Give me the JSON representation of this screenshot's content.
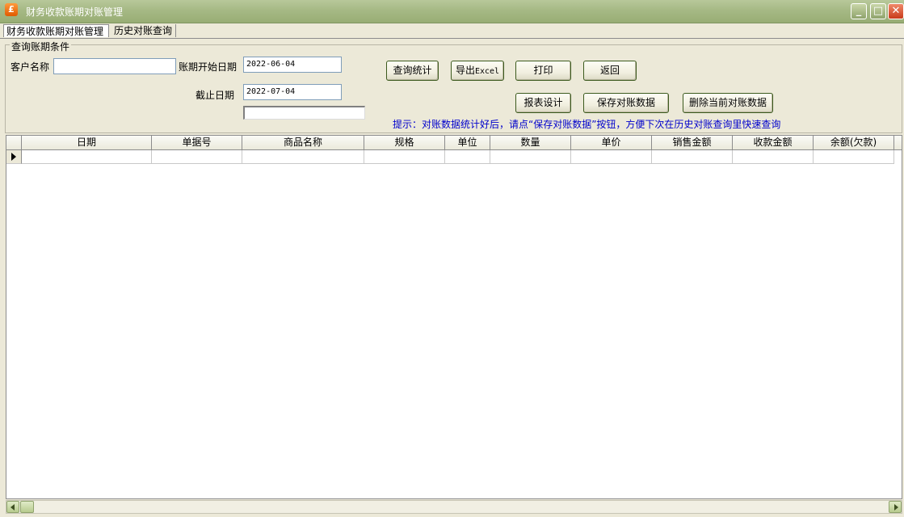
{
  "window": {
    "title": "财务收款账期对账管理",
    "icon": "app-icon",
    "icon_glyph": "£",
    "minimize": "_",
    "maximize": "□",
    "close": "✕"
  },
  "tabs": [
    {
      "label": "财务收款账期对账管理",
      "active": true
    },
    {
      "label": "历史对账查询",
      "active": false
    }
  ],
  "query": {
    "group_title": "查询账期条件",
    "customer_label": "客户名称",
    "customer_value": "",
    "start_label": "账期开始日期",
    "start_value": "2022-06-04",
    "end_label": "截止日期",
    "end_value": "2022-07-04",
    "extra_value": ""
  },
  "buttons": {
    "query_stats": "查询统计",
    "export_excel_prefix": "导出",
    "export_excel_suffix": "Excel",
    "print": "打印",
    "back": "返回",
    "report_design": "报表设计",
    "save_data": "保存对账数据",
    "delete_data": "删除当前对账数据"
  },
  "hint": "提示：对账数据统计好后，请点“保存对账数据”按钮，方便下次在历史对账查询里快速查询",
  "grid": {
    "columns": [
      "日期",
      "单据号",
      "商品名称",
      "规格",
      "单位",
      "数量",
      "单价",
      "销售金额",
      "收款金额",
      "余额(欠款)"
    ],
    "rows": [
      [
        "",
        "",
        "",
        "",
        "",
        "",
        "",
        "",
        "",
        ""
      ]
    ]
  },
  "colors": {
    "titlebar": "#a6b985",
    "hint_text": "#0000cc",
    "background": "#ece9d8"
  }
}
